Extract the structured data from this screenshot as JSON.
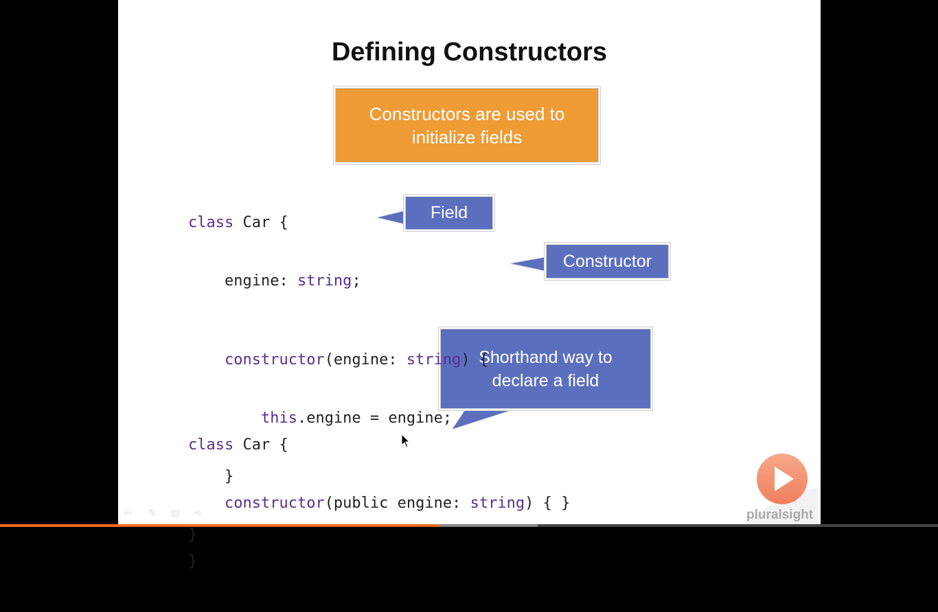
{
  "slide": {
    "title": "Defining Constructors",
    "callouts": {
      "main": "Constructors are used to initialize fields",
      "field": "Field",
      "constructor": "Constructor",
      "shorthand": "Shorthand way to declare a field"
    },
    "code_block_1": [
      {
        "kw": "class",
        "text": " Car {"
      },
      {
        "pre": "    engine: ",
        "kw": "string",
        "text": ";"
      },
      {
        "pre": "    ",
        "kw": "constructor",
        "text": "(engine: ",
        "kw2": "string",
        "text2": ") {"
      },
      {
        "pre": "        ",
        "kw": "this",
        "text": ".engine = engine;"
      },
      {
        "text": "    }"
      },
      {
        "text": "}"
      }
    ],
    "code_block_2": [
      {
        "kw": "class",
        "text": " Car {"
      },
      {
        "pre": "    ",
        "kw": "constructor",
        "text": "(public engine: ",
        "kw2": "string",
        "text2": ") { }"
      },
      {
        "text": "}"
      }
    ]
  },
  "player": {
    "logo_text": "pluralsight",
    "progress": 0.469,
    "buffered": 0.573,
    "icons": [
      "back-icon",
      "pen-icon",
      "menu-icon",
      "forward-icon"
    ]
  },
  "colors": {
    "orange_callout": "#ef9b36",
    "blue_callout": "#5b6fbe",
    "keyword": "#5a2d91",
    "progress": "#f26a21"
  }
}
